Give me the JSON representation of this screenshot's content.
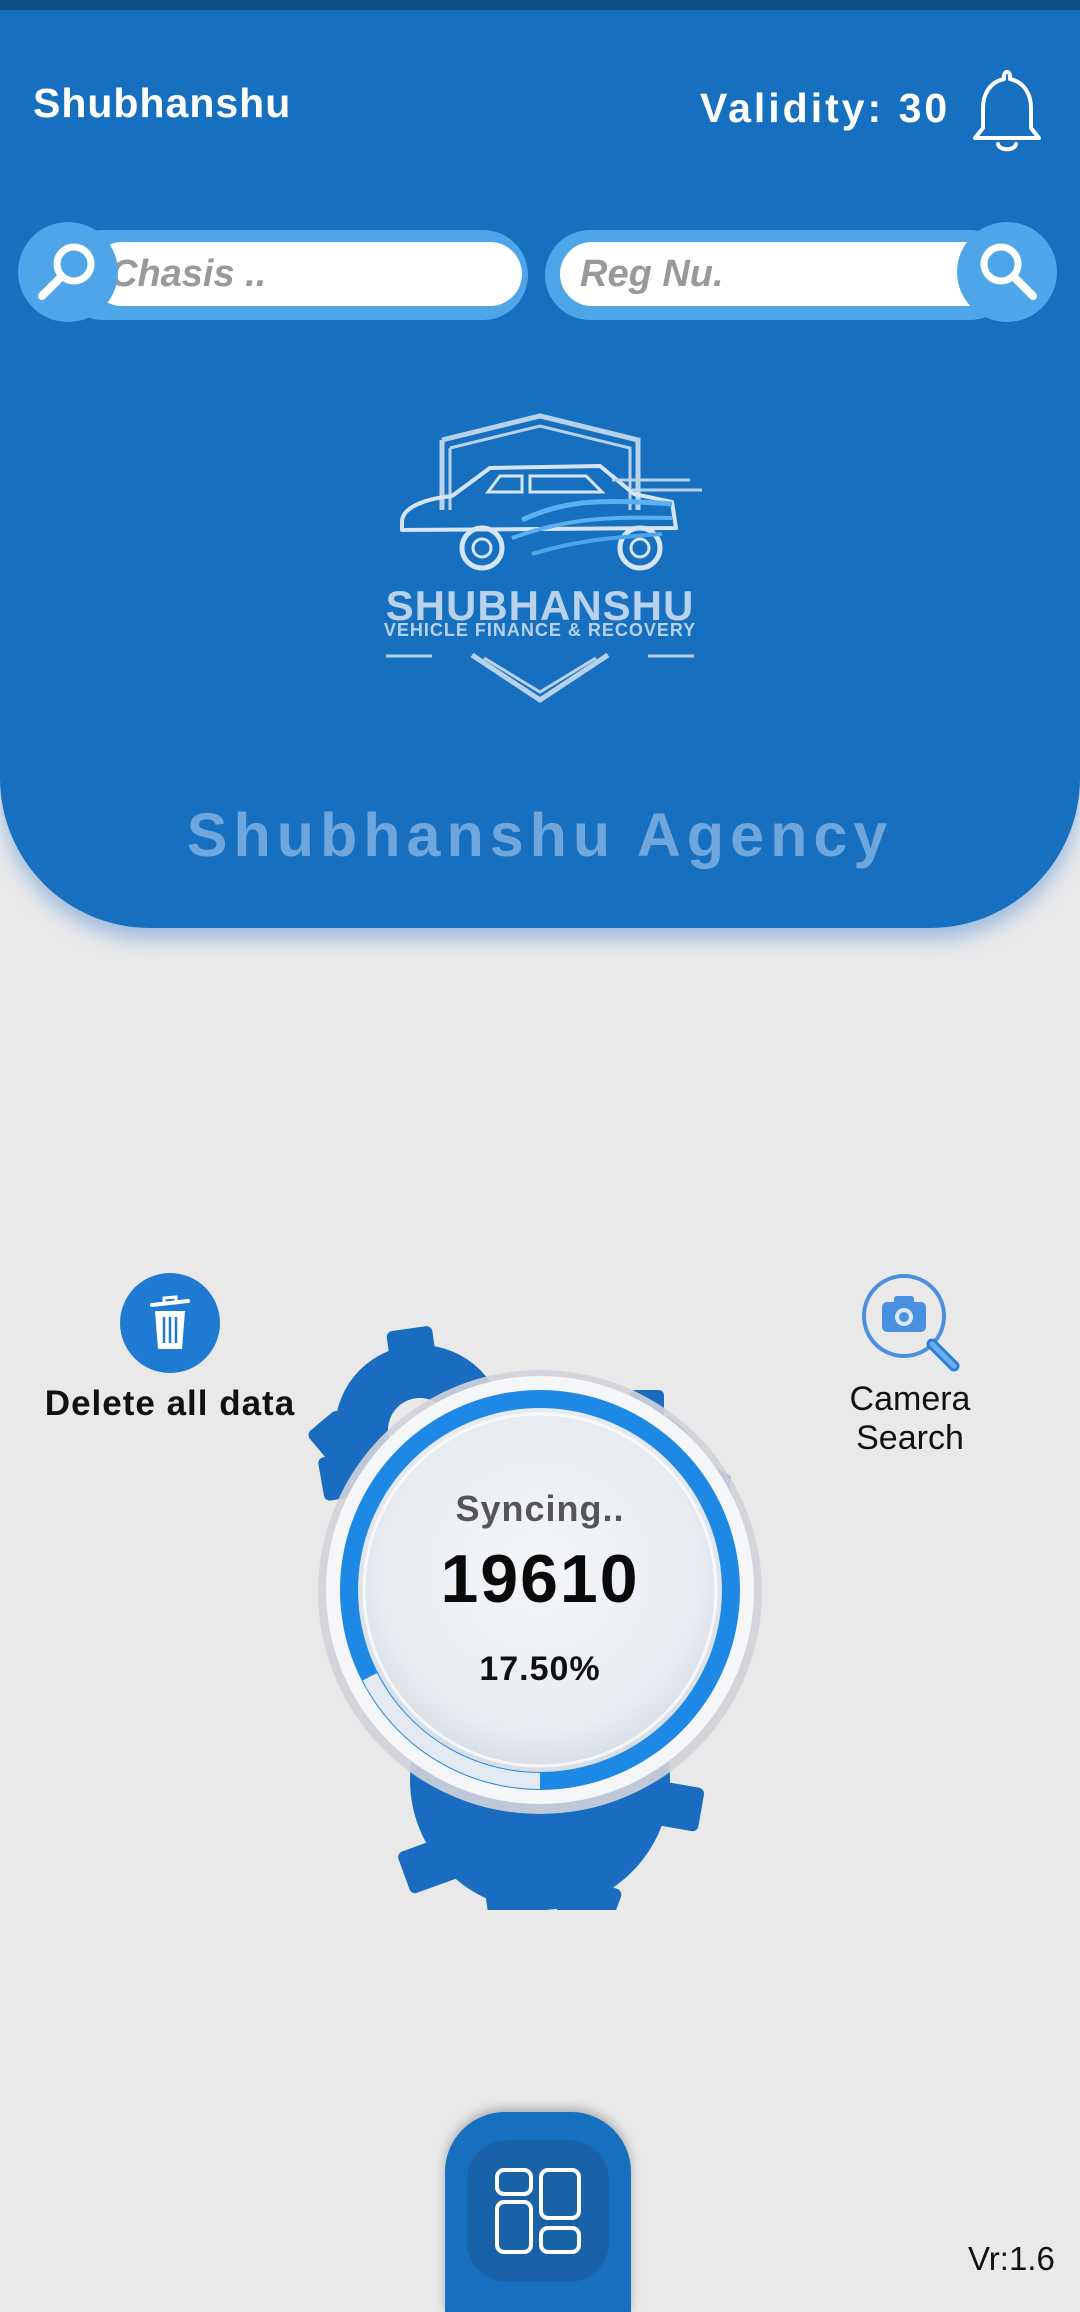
{
  "header": {
    "user_name": "Shubhanshu",
    "validity": "Validity: 30",
    "agency_name": "Shubhanshu Agency"
  },
  "search": {
    "chasis_placeholder": "Chasis ..",
    "reg_placeholder": "Reg Nu."
  },
  "logo": {
    "title": "SHUBHANSHU",
    "subtitle": "VEHICLE FINANCE & RECOVERY"
  },
  "actions": {
    "delete_label": "Delete all data",
    "camera_label": "Camera Search"
  },
  "sync": {
    "status": "Syncing..",
    "count": "19610",
    "percent_label": "17.50%",
    "progress_fraction": 0.175
  },
  "footer": {
    "version": "Vr:1.6"
  },
  "colors": {
    "primary": "#1670bf",
    "accent": "#4ea6e8",
    "ring": "#1e88e5",
    "background": "#e9e9ea"
  },
  "icons": [
    "bell-icon",
    "search-icon",
    "trash-icon",
    "camera-search-icon",
    "dashboard-grid-icon",
    "car-shield-logo"
  ]
}
